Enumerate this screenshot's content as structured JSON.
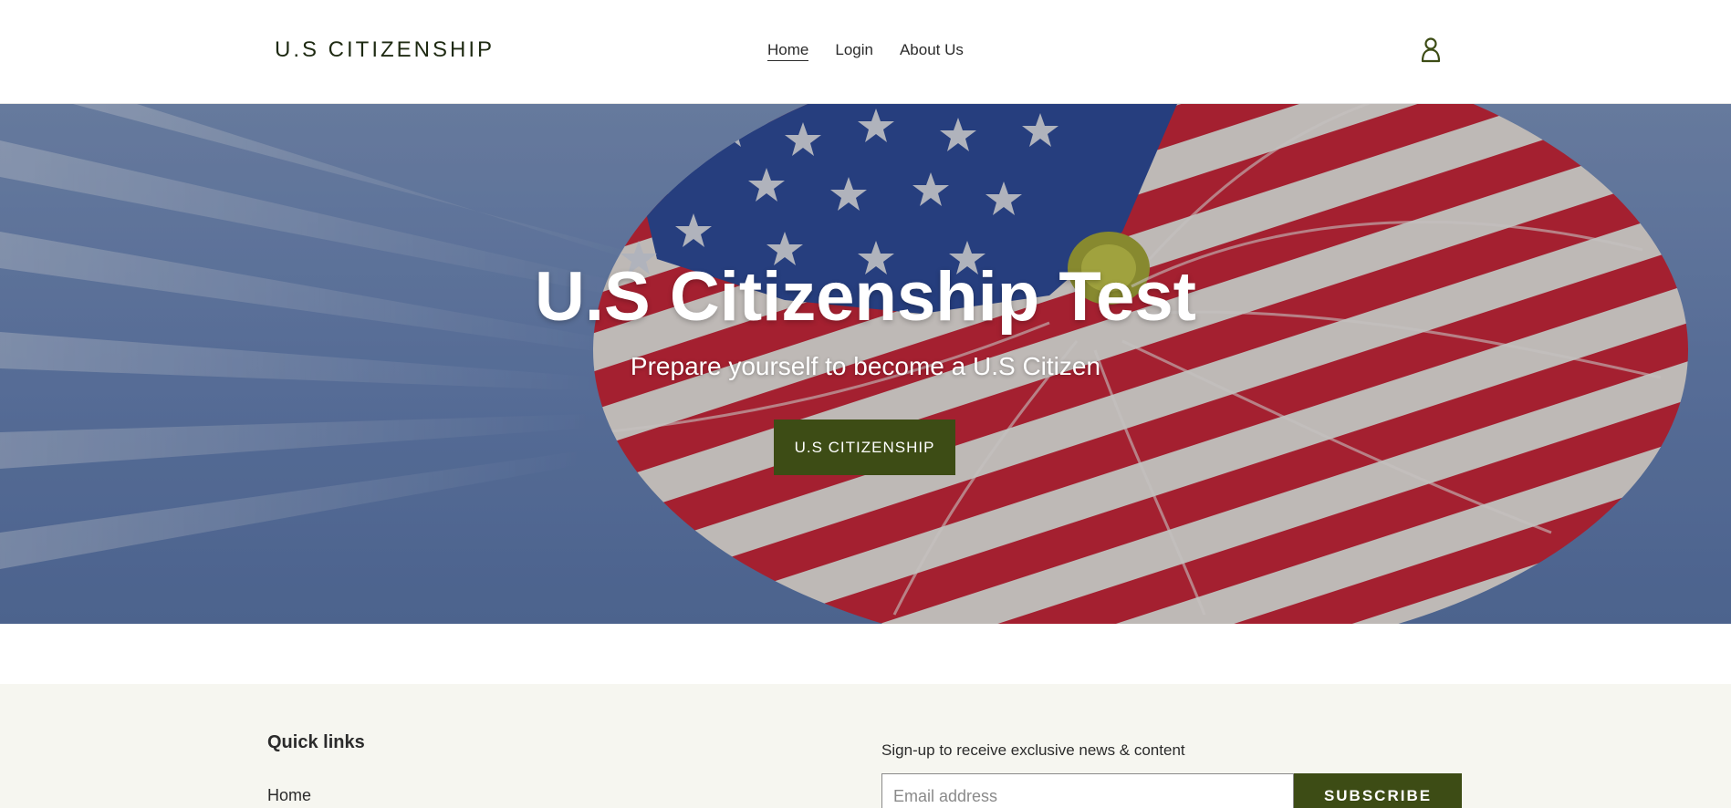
{
  "header": {
    "logo": "U.S CITIZENSHIP",
    "nav": [
      {
        "label": "Home",
        "active": true
      },
      {
        "label": "Login",
        "active": false
      },
      {
        "label": "About Us",
        "active": false
      }
    ],
    "account_icon": "user-icon"
  },
  "hero": {
    "title": "U.S Citizenship Test",
    "subtitle": "Prepare yourself to become a U.S Citizen",
    "button_label": "U.S CITIZENSHIP"
  },
  "footer": {
    "quick_links_heading": "Quick links",
    "links": [
      {
        "label": "Home"
      }
    ],
    "signup_text": "Sign-up to receive exclusive news & content",
    "email_placeholder": "Email address",
    "subscribe_label": "SUBSCRIBE"
  },
  "colors": {
    "brand_green": "#3d4c15",
    "footer_bg": "#f6f6f0",
    "flag_red": "#c8283b",
    "flag_blue": "#2f4c9a"
  }
}
